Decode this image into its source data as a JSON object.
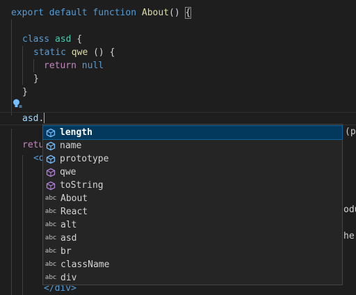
{
  "code": {
    "line1": {
      "export": "export",
      "default": "default",
      "function": "function",
      "name": "About",
      "parens": "()",
      "brace": "{"
    },
    "class_line": {
      "class": "class",
      "name": "asd",
      "brace": "{"
    },
    "static_line": {
      "static": "static",
      "name": "qwe",
      "parens": "()",
      "brace": "{"
    },
    "return_line": {
      "return": "return",
      "value": "null"
    },
    "close_inner": "}",
    "close_class": "}",
    "typing_line": {
      "ident": "asd",
      "dot": "."
    },
    "return2": "retu",
    "jsx_open": "<d",
    "jsx_close": "</div>",
    "peek_text": "(p",
    "right_fragment_1": "odu",
    "right_fragment_2": "he"
  },
  "suggest": {
    "items": [
      {
        "label": "length",
        "kind": "property",
        "icon": "property-icon",
        "selected": true
      },
      {
        "label": "name",
        "kind": "property",
        "icon": "property-icon"
      },
      {
        "label": "prototype",
        "kind": "property",
        "icon": "property-icon"
      },
      {
        "label": "qwe",
        "kind": "method",
        "icon": "method-icon"
      },
      {
        "label": "toString",
        "kind": "method",
        "icon": "method-icon"
      },
      {
        "label": "About",
        "kind": "text",
        "icon": "abc"
      },
      {
        "label": "React",
        "kind": "text",
        "icon": "abc"
      },
      {
        "label": "alt",
        "kind": "text",
        "icon": "abc"
      },
      {
        "label": "asd",
        "kind": "text",
        "icon": "abc"
      },
      {
        "label": "br",
        "kind": "text",
        "icon": "abc"
      },
      {
        "label": "className",
        "kind": "text",
        "icon": "abc"
      },
      {
        "label": "div",
        "kind": "text",
        "icon": "abc"
      }
    ]
  },
  "colors": {
    "property": "#75beff",
    "method": "#b180d7",
    "selected_bg": "#04395e"
  }
}
